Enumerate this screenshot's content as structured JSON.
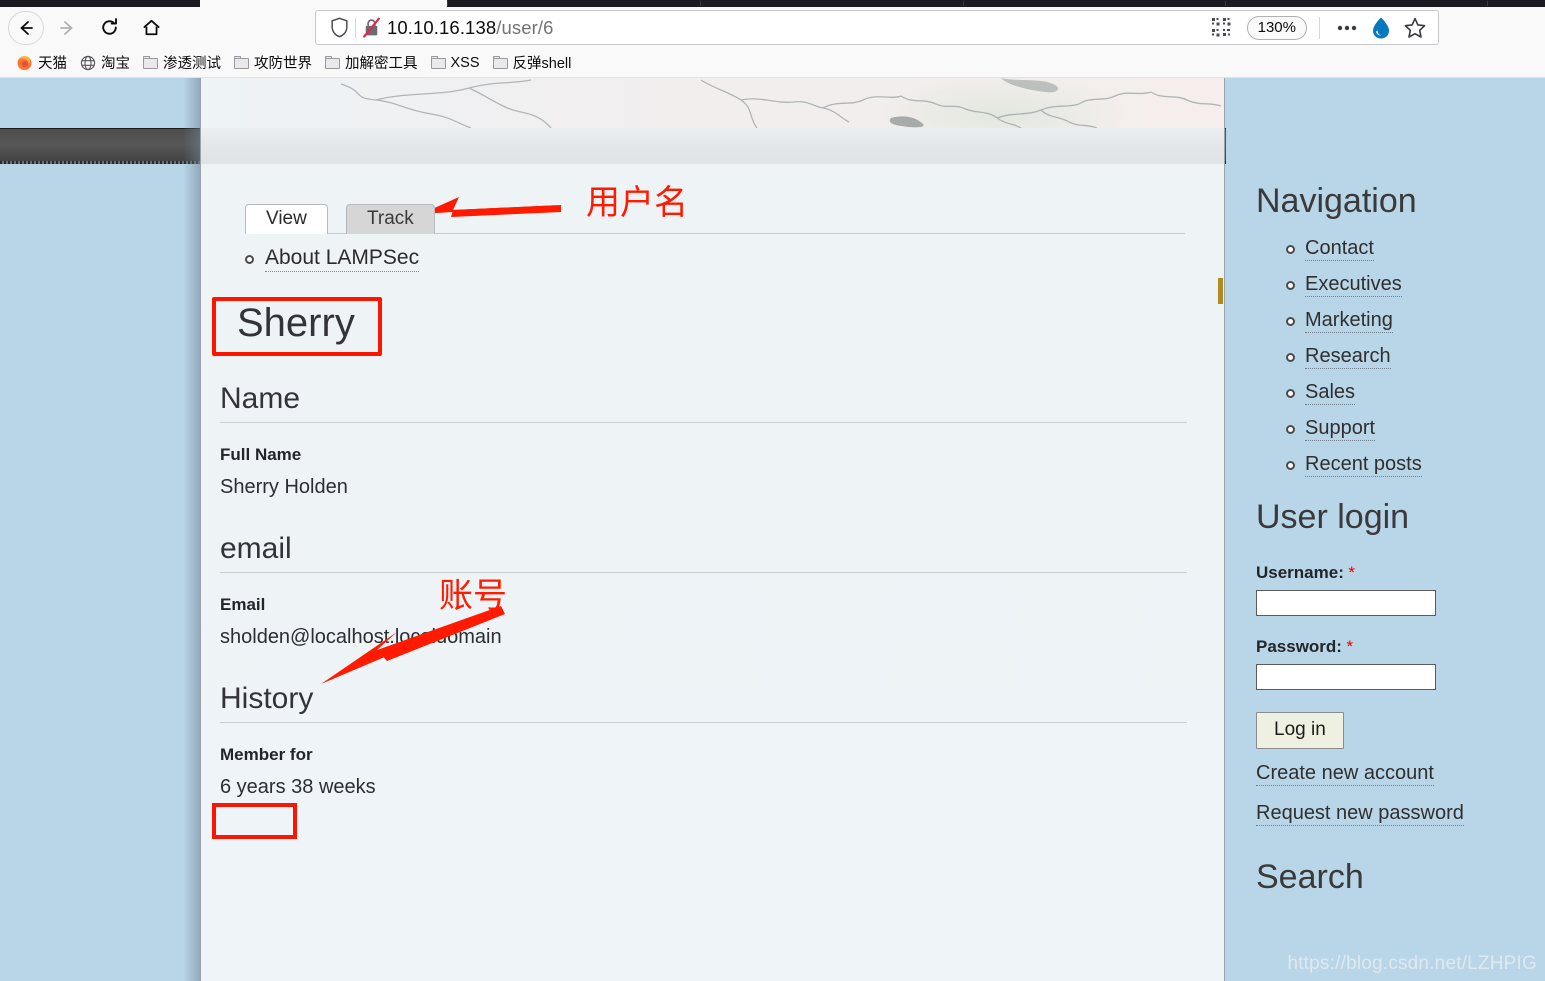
{
  "browser": {
    "nav": {
      "back_label": "Back",
      "forward_label": "Forward",
      "reload_label": "Reload",
      "home_label": "Home"
    },
    "urlbar": {
      "shield_icon": "shield-icon",
      "lock_crossed_icon": "lock-crossed-out-icon",
      "url_host": "10.10.16.138",
      "url_path": "/user/6",
      "qr_icon": "qr-code-icon",
      "zoom_level": "130%",
      "more_icon": "ellipsis-icon",
      "drupal_icon": "drupal-drop-icon",
      "bookmark_icon": "star-icon"
    },
    "bookmarks": [
      {
        "label": "天猫",
        "icon": "firefox-icon"
      },
      {
        "label": "淘宝",
        "icon": "globe-icon"
      },
      {
        "label": "渗透测试",
        "icon": "folder-icon"
      },
      {
        "label": "攻防世界",
        "icon": "folder-icon"
      },
      {
        "label": "加解密工具",
        "icon": "folder-icon"
      },
      {
        "label": "XSS",
        "icon": "folder-icon"
      },
      {
        "label": "反弹shell",
        "icon": "folder-icon"
      }
    ]
  },
  "page": {
    "tabs": [
      {
        "label": "View",
        "active": true
      },
      {
        "label": "Track",
        "active": false
      }
    ],
    "breadcrumb_link": "About LAMPSec",
    "title": "Sherry",
    "sections": [
      {
        "heading": "Name",
        "field_label": "Full Name",
        "field_value": "Sherry Holden"
      },
      {
        "heading": "email",
        "field_label": "Email",
        "field_value": "sholden@localhost.localdomain"
      },
      {
        "heading": "History",
        "field_label": "Member for",
        "field_value": "6 years 38 weeks"
      }
    ]
  },
  "annotations": {
    "color": "#ff1a00",
    "username_note": "用户名",
    "email_note": "账号"
  },
  "sidebar": {
    "navigation": {
      "heading": "Navigation",
      "items": [
        {
          "label": "Contact"
        },
        {
          "label": "Executives"
        },
        {
          "label": "Marketing"
        },
        {
          "label": "Research"
        },
        {
          "label": "Sales"
        },
        {
          "label": "Support"
        },
        {
          "label": "Recent posts"
        }
      ]
    },
    "user_login": {
      "heading": "User login",
      "username_label": "Username:",
      "username_value": "",
      "password_label": "Password:",
      "password_value": "",
      "required_mark": "*",
      "submit_label": "Log in",
      "create_account_label": "Create new account",
      "request_password_label": "Request new password"
    },
    "search": {
      "heading": "Search"
    }
  },
  "watermark": "https://blog.csdn.net/LZHPIG"
}
